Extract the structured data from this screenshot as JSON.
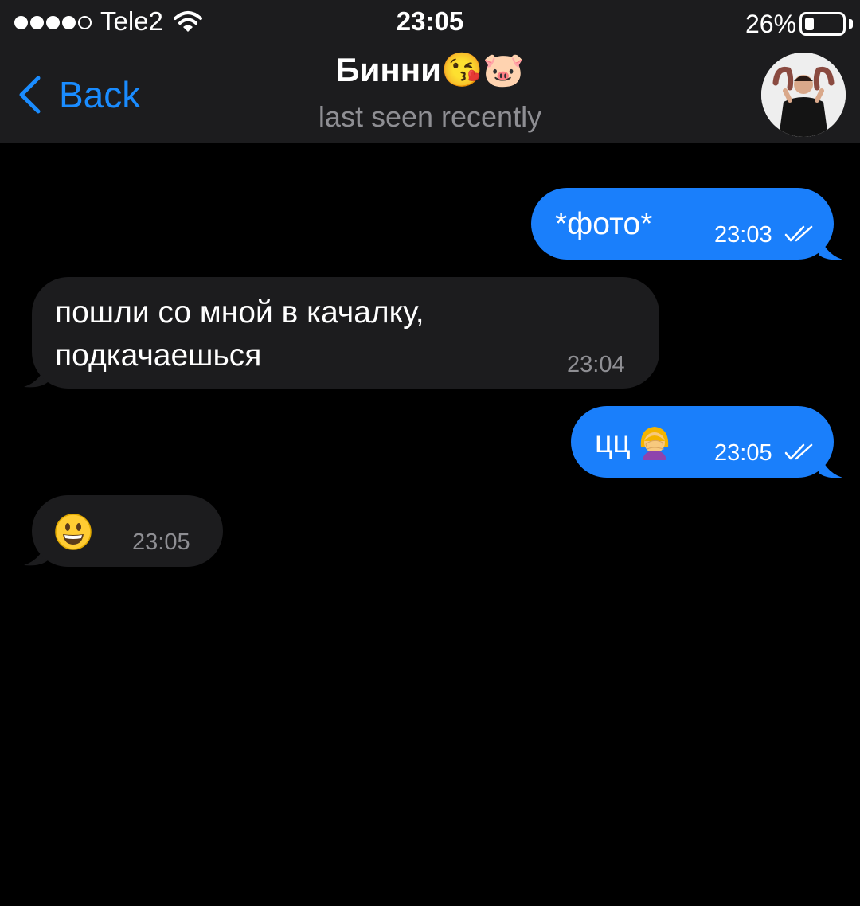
{
  "status_bar": {
    "carrier": "Tele2",
    "time": "23:05",
    "battery_percent": "26%",
    "battery_level": 0.26,
    "signal_bars_filled": 4,
    "signal_bars_total": 5
  },
  "nav": {
    "back_label": "Back",
    "title": "Бинни😘🐷",
    "subtitle": "last seen recently"
  },
  "colors": {
    "accent": "#1a8cff",
    "outgoing_bubble": "#1a7ffb",
    "incoming_bubble": "#1c1c1e",
    "header_bg": "#1c1c1e",
    "chat_bg": "#000000"
  },
  "messages": [
    {
      "direction": "outgoing",
      "text": "*фото*",
      "time": "23:03",
      "read": true
    },
    {
      "direction": "incoming",
      "lines": [
        "пошли со мной в качалку,",
        "подкачаешься"
      ],
      "time": "23:04"
    },
    {
      "direction": "outgoing",
      "text": "цц",
      "emoji": "woman-facepalming",
      "time": "23:05",
      "read": true
    },
    {
      "direction": "incoming",
      "emoji": "smiling-face-open-mouth",
      "time": "23:05"
    }
  ]
}
